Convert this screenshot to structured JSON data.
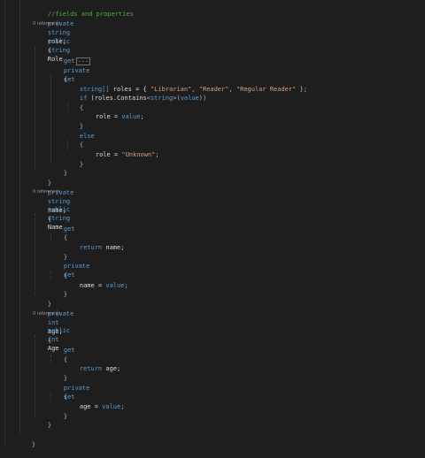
{
  "editor": {
    "code": {
      "comment_fields": "//fields and properties",
      "private_kw": "private",
      "public_kw": "public",
      "string_kw": "string",
      "int_kw": "int",
      "get_kw": "get",
      "set_kw": "set",
      "return_kw": "return",
      "if_kw": "if",
      "else_kw": "else",
      "value_kw": "value",
      "role_field": "role;",
      "role_prop": "Role",
      "name_field": "name;",
      "name_prop": "Name",
      "age_field": "age;",
      "age_prop": "Age",
      "open_brace": "{",
      "close_brace": "}",
      "collapsed_marker": "...",
      "string_array": "string[]",
      "roles_decl": " roles = { ",
      "librarian": "\"Librarian\"",
      "reader": "\"Reader\"",
      "regular_reader": "\"Regular Reader\"",
      "comma": ", ",
      "array_end": " };",
      "if_roles_contains": " (roles.Contains",
      "generic_open": "<",
      "generic_close": ">",
      "value_paren_open": "(",
      "value_paren_close": "))",
      "role_assign": "role = ",
      "semicolon": ";",
      "unknown": "\"Unknown\"",
      "return_name": " name;",
      "name_assign": "name = ",
      "return_age": " age;",
      "age_assign": "age = "
    },
    "codelens": {
      "zero_refs": "0 references"
    }
  }
}
